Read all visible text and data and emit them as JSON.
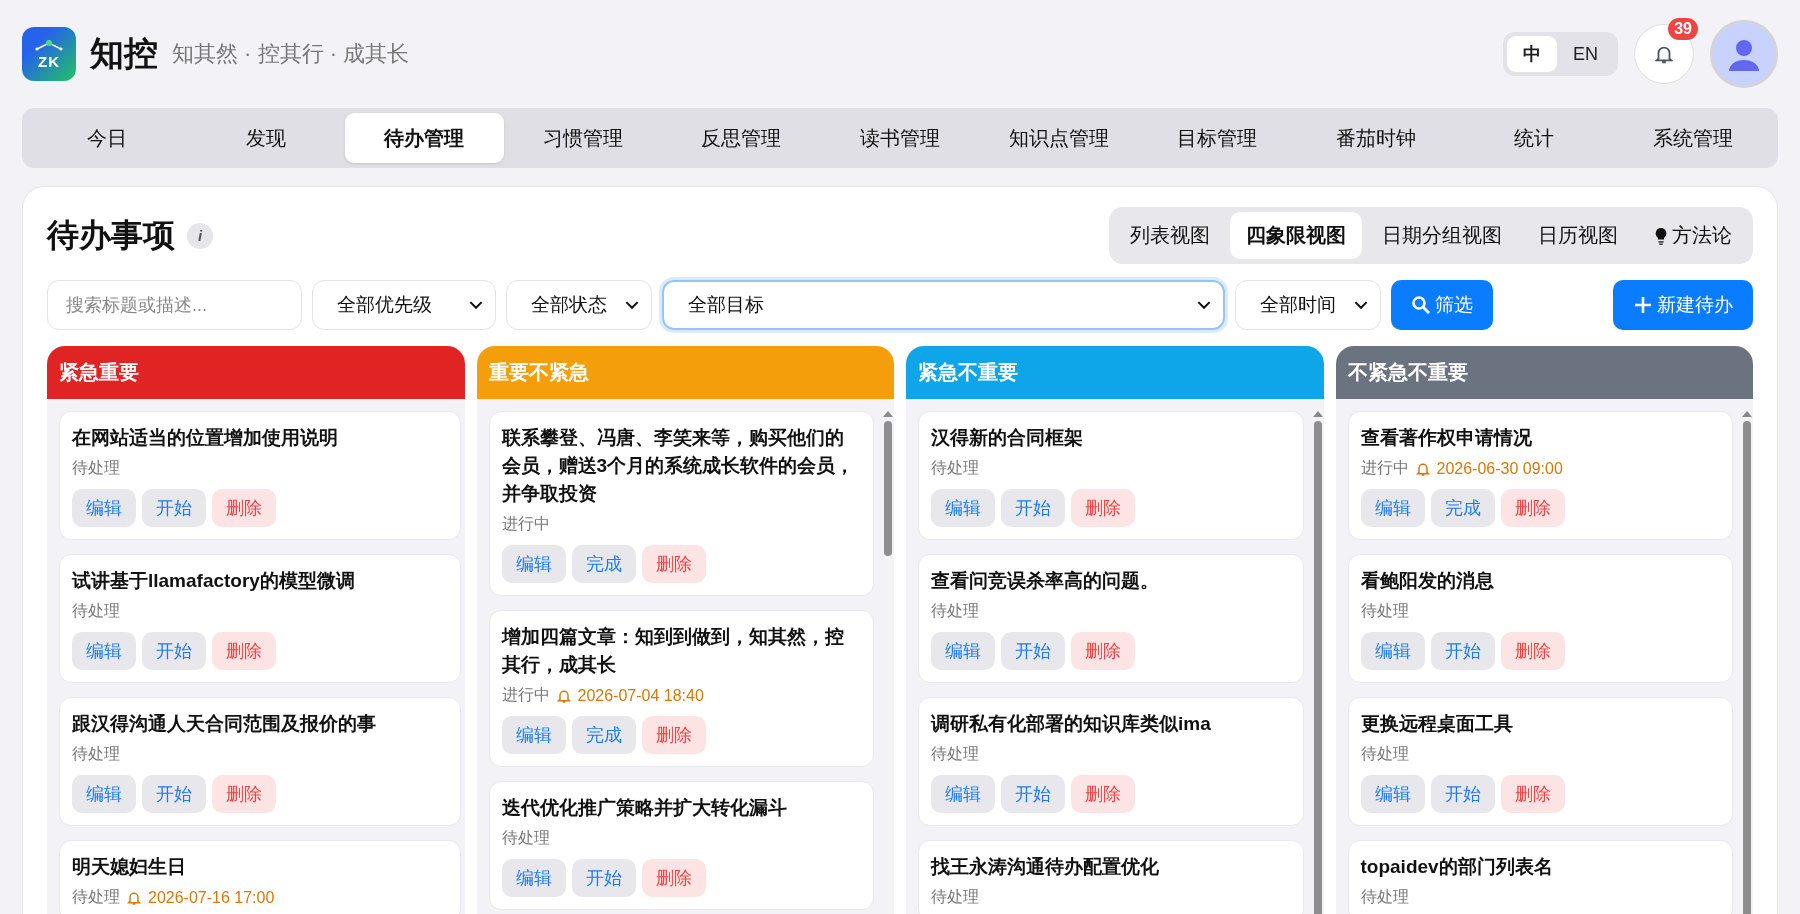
{
  "brand": {
    "logo_text": "ZK",
    "name": "知控",
    "slogan": "知其然 · 控其行 · 成其长"
  },
  "language": [
    {
      "label": "中",
      "selected": true
    },
    {
      "label": "EN",
      "selected": false
    }
  ],
  "notifications": {
    "count": "39"
  },
  "nav": [
    {
      "label": "今日",
      "selected": false
    },
    {
      "label": "发现",
      "selected": false
    },
    {
      "label": "待办管理",
      "selected": true
    },
    {
      "label": "习惯管理",
      "selected": false
    },
    {
      "label": "反思管理",
      "selected": false
    },
    {
      "label": "读书管理",
      "selected": false
    },
    {
      "label": "知识点管理",
      "selected": false
    },
    {
      "label": "目标管理",
      "selected": false
    },
    {
      "label": "番茄时钟",
      "selected": false
    },
    {
      "label": "统计",
      "selected": false
    },
    {
      "label": "系统管理",
      "selected": false
    }
  ],
  "page": {
    "title": "待办事项",
    "info": "i"
  },
  "views": [
    {
      "label": "列表视图",
      "selected": false,
      "kind": "view"
    },
    {
      "label": "四象限视图",
      "selected": true,
      "kind": "view"
    },
    {
      "label": "日期分组视图",
      "selected": false,
      "kind": "view"
    },
    {
      "label": "日历视图",
      "selected": false,
      "kind": "view"
    },
    {
      "label": "方法论",
      "selected": false,
      "kind": "tip"
    }
  ],
  "filters": {
    "search_placeholder": "搜索标题或描述...",
    "priority": "全部优先级",
    "status": "全部状态",
    "goal": "全部目标",
    "time": "全部时间",
    "filter_button": "筛选",
    "new_button": "新建待办"
  },
  "quadrants": [
    {
      "title": "紧急重要",
      "color": "#e02424",
      "scrollbar": false,
      "cards": [
        {
          "title": "在网站适当的位置增加使用说明",
          "status": "待处理",
          "actions": [
            {
              "label": "编辑",
              "kind": "edit"
            },
            {
              "label": "开始",
              "kind": "start"
            },
            {
              "label": "删除",
              "kind": "delete"
            }
          ]
        },
        {
          "title": "试讲基于llamafactory的模型微调",
          "status": "待处理",
          "actions": [
            {
              "label": "编辑",
              "kind": "edit"
            },
            {
              "label": "开始",
              "kind": "start"
            },
            {
              "label": "删除",
              "kind": "delete"
            }
          ]
        },
        {
          "title": "跟汉得沟通人天合同范围及报价的事",
          "status": "待处理",
          "actions": [
            {
              "label": "编辑",
              "kind": "edit"
            },
            {
              "label": "开始",
              "kind": "start"
            },
            {
              "label": "删除",
              "kind": "delete"
            }
          ]
        },
        {
          "title": "明天媳妇生日",
          "status": "待处理",
          "reminder": "2026-07-16 17:00"
        }
      ]
    },
    {
      "title": "重要不紧急",
      "color": "#f59e0b",
      "scrollbar": true,
      "cards": [
        {
          "title": "联系攀登、冯唐、李笑来等，购买他们的会员，赠送3个月的系统成长软件的会员，并争取投资",
          "status": "进行中",
          "actions": [
            {
              "label": "编辑",
              "kind": "edit"
            },
            {
              "label": "完成",
              "kind": "complete"
            },
            {
              "label": "删除",
              "kind": "delete"
            }
          ]
        },
        {
          "title": "增加四篇文章：知到到做到，知其然，控其行，成其长",
          "status": "进行中",
          "reminder": "2026-07-04 18:40",
          "actions": [
            {
              "label": "编辑",
              "kind": "edit"
            },
            {
              "label": "完成",
              "kind": "complete"
            },
            {
              "label": "删除",
              "kind": "delete"
            }
          ]
        },
        {
          "title": "迭代优化推广策略并扩大转化漏斗",
          "status": "待处理",
          "actions": [
            {
              "label": "编辑",
              "kind": "edit"
            },
            {
              "label": "开始",
              "kind": "start"
            },
            {
              "label": "删除",
              "kind": "delete"
            }
          ]
        }
      ]
    },
    {
      "title": "紧急不重要",
      "color": "#0ea5e9",
      "scrollbar": true,
      "cards": [
        {
          "title": "汉得新的合同框架",
          "status": "待处理",
          "actions": [
            {
              "label": "编辑",
              "kind": "edit"
            },
            {
              "label": "开始",
              "kind": "start"
            },
            {
              "label": "删除",
              "kind": "delete"
            }
          ]
        },
        {
          "title": "查看问竞误杀率高的问题。",
          "status": "待处理",
          "actions": [
            {
              "label": "编辑",
              "kind": "edit"
            },
            {
              "label": "开始",
              "kind": "start"
            },
            {
              "label": "删除",
              "kind": "delete"
            }
          ]
        },
        {
          "title": "调研私有化部署的知识库类似ima",
          "status": "待处理",
          "actions": [
            {
              "label": "编辑",
              "kind": "edit"
            },
            {
              "label": "开始",
              "kind": "start"
            },
            {
              "label": "删除",
              "kind": "delete"
            }
          ]
        },
        {
          "title": "找王永涛沟通待办配置优化",
          "status": "待处理"
        }
      ]
    },
    {
      "title": "不紧急不重要",
      "color": "#6b7280",
      "scrollbar": true,
      "cards": [
        {
          "title": "查看著作权申请情况",
          "status": "进行中",
          "reminder": "2026-06-30 09:00",
          "actions": [
            {
              "label": "编辑",
              "kind": "edit"
            },
            {
              "label": "完成",
              "kind": "complete"
            },
            {
              "label": "删除",
              "kind": "delete"
            }
          ]
        },
        {
          "title": "看鲍阳发的消息",
          "status": "待处理",
          "actions": [
            {
              "label": "编辑",
              "kind": "edit"
            },
            {
              "label": "开始",
              "kind": "start"
            },
            {
              "label": "删除",
              "kind": "delete"
            }
          ]
        },
        {
          "title": "更换远程桌面工具",
          "status": "待处理",
          "actions": [
            {
              "label": "编辑",
              "kind": "edit"
            },
            {
              "label": "开始",
              "kind": "start"
            },
            {
              "label": "删除",
              "kind": "delete"
            }
          ]
        },
        {
          "title": "topaidev的部门列表名",
          "status": "待处理"
        }
      ]
    }
  ]
}
